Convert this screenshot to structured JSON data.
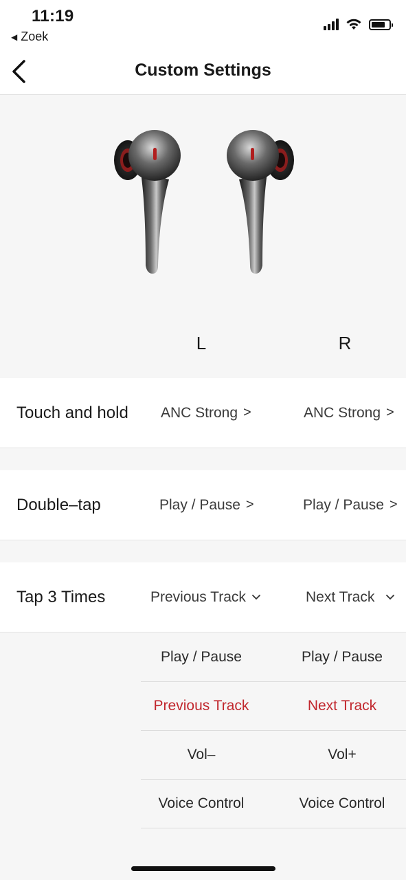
{
  "status_bar": {
    "time": "11:19",
    "back_app": "Zoek",
    "icons": [
      "signal-icon",
      "wifi-icon",
      "battery-icon"
    ]
  },
  "nav": {
    "title": "Custom Settings",
    "back_icon": "chevron-left-icon"
  },
  "columns": {
    "left": "L",
    "right": "R"
  },
  "rows": [
    {
      "label": "Touch and hold",
      "left": "ANC Strong",
      "right": "ANC Strong",
      "indicator": ">"
    },
    {
      "label": "Double–tap",
      "left": "Play / Pause",
      "right": "Play / Pause",
      "indicator": ">"
    },
    {
      "label": "Tap 3 Times",
      "left": "Previous Track",
      "right": "Next Track",
      "indicator": "chevron-down"
    }
  ],
  "options": {
    "left": [
      "Play / Pause",
      "Previous Track",
      "Vol–",
      "Voice Control"
    ],
    "right": [
      "Play / Pause",
      "Next Track",
      "Vol+",
      "Voice Control"
    ],
    "selected_left": "Previous Track",
    "selected_right": "Next Track"
  },
  "colors": {
    "accent": "#c1272d",
    "background": "#f6f6f6",
    "surface": "#ffffff"
  }
}
